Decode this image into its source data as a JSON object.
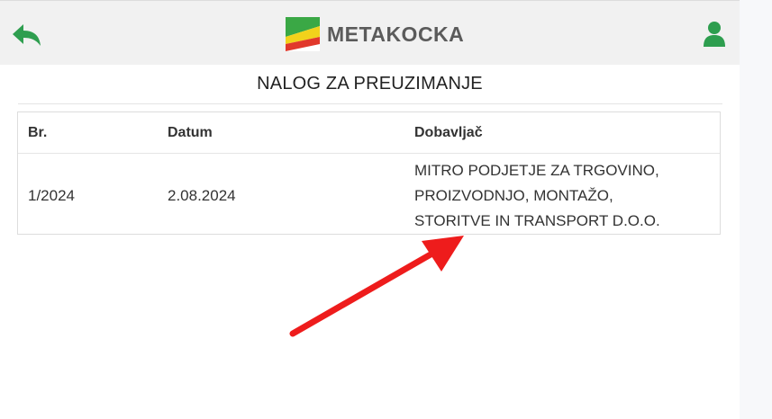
{
  "header": {
    "brand": "METAKOCKA",
    "back_icon": "back-arrow-icon",
    "user_icon": "user-icon",
    "accent_color": "#2e9e4f"
  },
  "page": {
    "title": "NALOG ZA PREUZIMANJE"
  },
  "table": {
    "columns": [
      "Br.",
      "Datum",
      "Dobavljač"
    ],
    "rows": [
      {
        "br": "1/2024",
        "datum": "2.08.2024",
        "dobavljac_lines": [
          "MITRO PODJETJE ZA TRGOVINO,",
          "PROIZVODNJO, MONTAŽO,",
          "STORITVE IN TRANSPORT D.O.O."
        ]
      }
    ]
  },
  "annotation": {
    "arrow_color": "#ee1c1c"
  }
}
